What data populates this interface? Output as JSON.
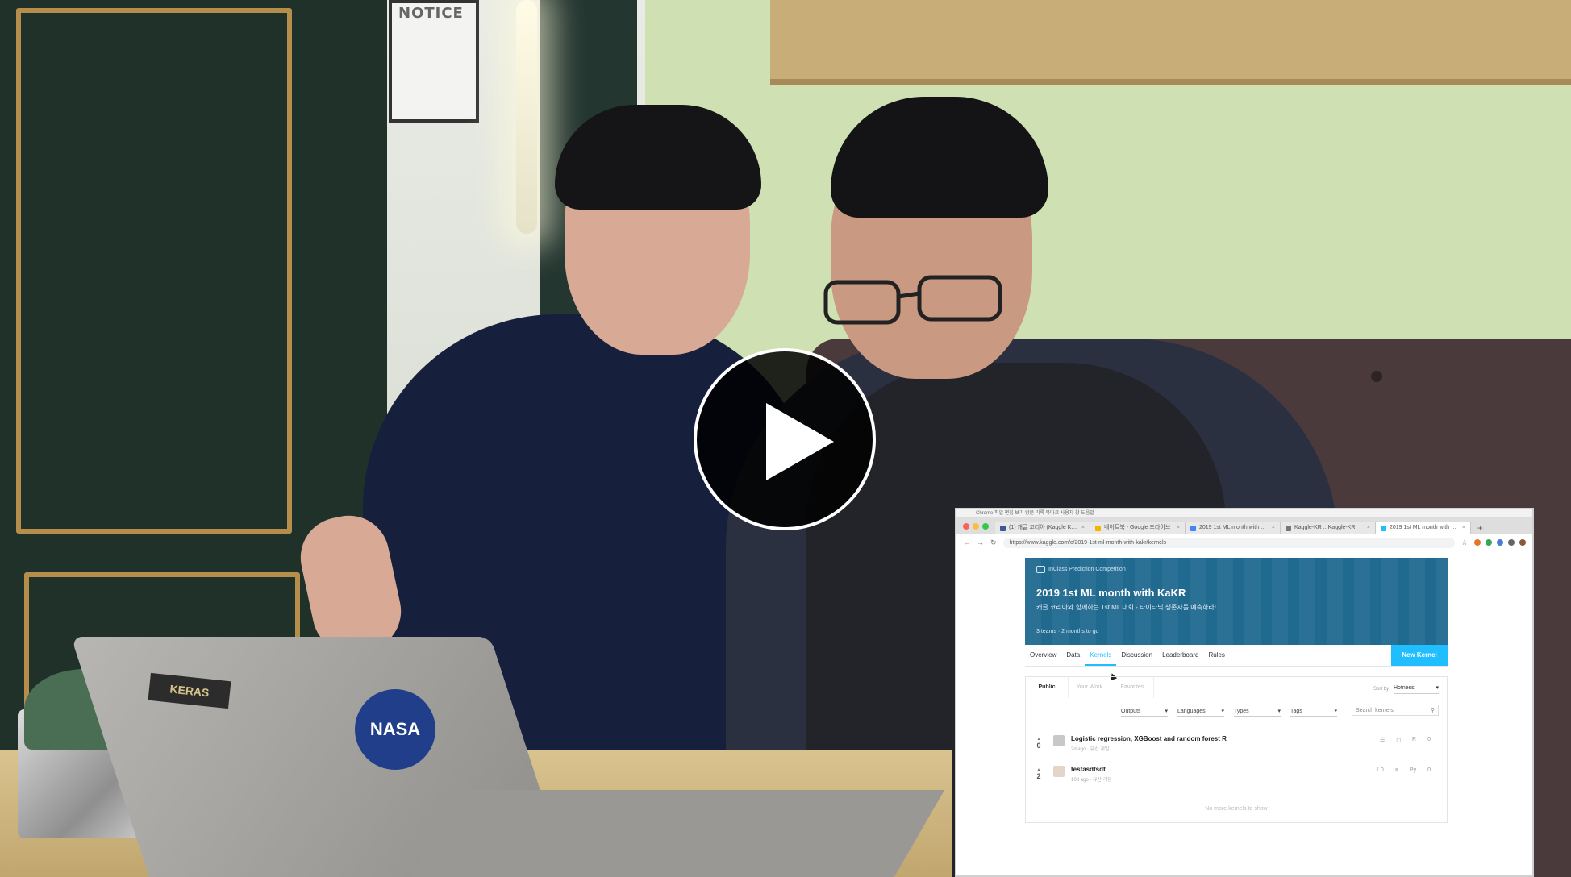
{
  "scene": {
    "notice_text": "NOTICE",
    "sticker_brand": "KERAS",
    "sticker_nasa": "NASA"
  },
  "player": {
    "play_icon": "play-icon"
  },
  "browser": {
    "menubar_text": "Chrome 파일 편집 보기 방문 기록 북마크 사용자 창 도움말",
    "tabs": [
      {
        "label": "(1) 캐글 코리아 (Kaggle Korea)",
        "x": "×",
        "favicon_color": "#3b5998"
      },
      {
        "label": "네이트북 - Google 드라이브",
        "x": "×",
        "favicon_color": "#f4b400"
      },
      {
        "label": "2019 1st ML month with KaKR",
        "x": "×",
        "favicon_color": "#4285f4"
      },
      {
        "label": "Kaggle-KR :: Kaggle-KR",
        "x": "×",
        "favicon_color": "#777777"
      },
      {
        "label": "2019 1st ML month with KaKR",
        "x": "×",
        "favicon_color": "#20beff"
      }
    ],
    "new_tab": "+",
    "url": "https://www.kaggle.com/c/2019-1st-ml-month-with-kakr/kernels"
  },
  "competition": {
    "type_label": "InClass Prediction Competition",
    "title": "2019 1st ML month with KaKR",
    "subtitle": "캐글 코리아와 함께하는 1st ML 대회 - 타이타닉 생존자를 예측하라!",
    "meta": "3 teams · 2 months to go",
    "nav": [
      "Overview",
      "Data",
      "Kernels",
      "Discussion",
      "Leaderboard",
      "Rules"
    ],
    "active_nav": "Kernels",
    "new_kernel_label": "New Kernel"
  },
  "kernels": {
    "subtabs": [
      "Public",
      "Your Work",
      "Favorites"
    ],
    "sort_label": "Sort by",
    "sort_value": "Hotness",
    "filters": [
      "Outputs",
      "Languages",
      "Types",
      "Tags"
    ],
    "search_placeholder": "Search kernels",
    "rows": [
      {
        "votes": "0",
        "title": "Logistic regression, XGBoost and random forest R",
        "meta": "2d ago · 유산 게임",
        "icons": [
          "☰",
          "◻",
          "R",
          "0"
        ]
      },
      {
        "votes": "2",
        "title": "testasdfsdf",
        "meta": "10d ago · 유산 게임",
        "icons": [
          "1.0",
          "≡",
          "Py",
          "0"
        ]
      }
    ],
    "empty_text": "No more kernels to show"
  }
}
